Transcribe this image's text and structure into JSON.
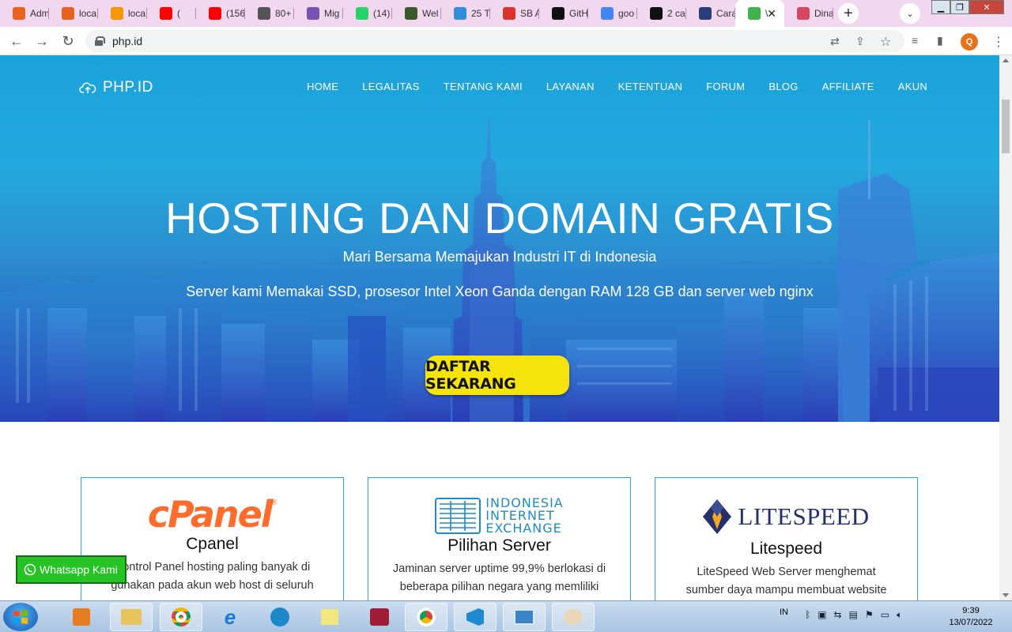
{
  "browser": {
    "tabs": [
      {
        "label": "Adm",
        "icon": "xampp-icon",
        "color": "#e8621f"
      },
      {
        "label": "loca",
        "icon": "xampp-icon",
        "color": "#e8621f"
      },
      {
        "label": "loca",
        "icon": "phpmyadmin-icon",
        "color": "#f39800"
      },
      {
        "label": "(",
        "icon": "youtube-icon",
        "color": "#ff0000"
      },
      {
        "label": "(156",
        "icon": "youtube-icon",
        "color": "#ff0000"
      },
      {
        "label": "80+",
        "icon": "et-icon",
        "color": "#555555"
      },
      {
        "label": "Mig",
        "icon": "bootstrap-icon",
        "color": "#7952b3"
      },
      {
        "label": "(14)",
        "icon": "whatsapp-icon",
        "color": "#25d366"
      },
      {
        "label": "Wel",
        "icon": "shield-icon",
        "color": "#3a5a2a"
      },
      {
        "label": "25 T",
        "icon": "cloud-icon",
        "color": "#2f8fd8"
      },
      {
        "label": "SB A",
        "icon": "s-icon",
        "color": "#d9342b"
      },
      {
        "label": "GitH",
        "icon": "github-icon",
        "color": "#111111"
      },
      {
        "label": "goo",
        "icon": "google-icon",
        "color": "#4285f4"
      },
      {
        "label": "2 ca",
        "icon": "dark-icon",
        "color": "#111111"
      },
      {
        "label": "Cara",
        "icon": "ld-icon",
        "color": "#2a3f7a"
      },
      {
        "label": "\\",
        "icon": "database-icon",
        "color": "#3eb34a",
        "active": true
      },
      {
        "label": "Dina",
        "icon": "drop-icon",
        "color": "#d9465f"
      }
    ],
    "url": "php.id",
    "profile_initial": "Q"
  },
  "site": {
    "brand": "PHP.ID",
    "nav": [
      "HOME",
      "LEGALITAS",
      "TENTANG KAMI",
      "LAYANAN",
      "KETENTUAN",
      "FORUM",
      "BLOG",
      "AFFILIATE",
      "AKUN"
    ],
    "hero_title": "HOSTING DAN DOMAIN GRATIS",
    "hero_subtitle": "Mari Bersama Memajukan Industri IT di Indonesia",
    "hero_text": "Server kami Memakai SSD, prosesor Intel Xeon Ganda dengan RAM 128 GB dan server web nginx",
    "cta": "DAFTAR SEKARANG",
    "features": [
      {
        "logo": "cPanel",
        "title": "Cpanel",
        "text": "Control Panel hosting paling banyak di gunakan pada akun web host di seluruh",
        "logo_color": "#ff6c2c"
      },
      {
        "logo_lines": [
          "INDONESIA",
          "INTERNET",
          "EXCHANGE"
        ],
        "title": "Pilihan Server",
        "text": "Jaminan server uptime 99,9% berlokasi di beberapa pilihan negara yang memliliki",
        "logo_color": "#1e8bc3"
      },
      {
        "logo": "LITESPEED",
        "title": "Litespeed",
        "text": "LiteSpeed Web Server menghemat sumber daya mampu membuat website",
        "logo_color": "#26316b"
      }
    ],
    "whatsapp": "Whatsapp Kami"
  },
  "taskbar": {
    "lang": "IN",
    "time": "9:39",
    "date": "13/07/2022"
  }
}
